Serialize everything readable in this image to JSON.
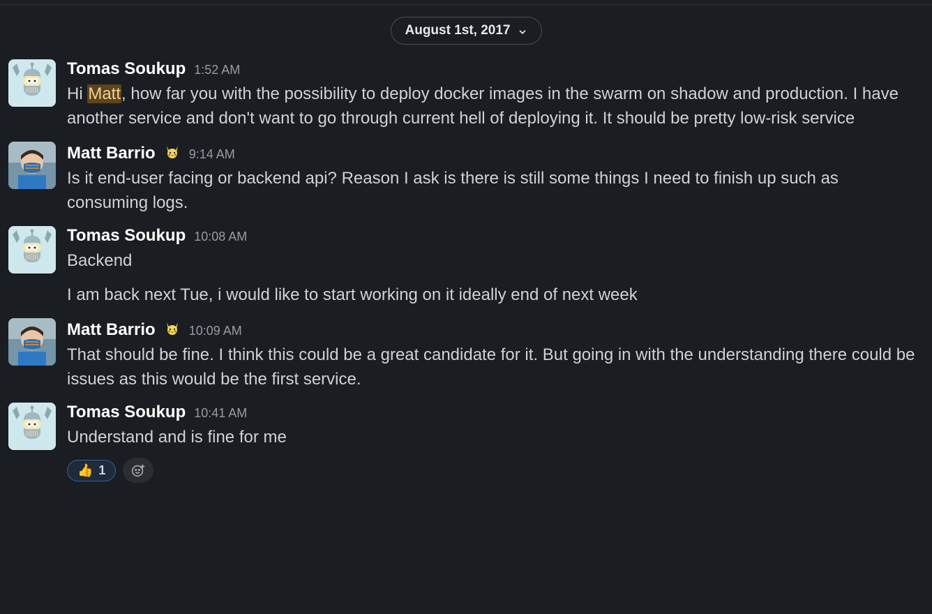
{
  "date_divider": "August 1st, 2017",
  "highlight_term": "Matt",
  "messages": [
    {
      "author": "Tomas Soukup",
      "avatar": "bender",
      "status_emoji": "",
      "time": "1:52 AM",
      "paragraphs": [
        "Hi Matt, how far you with the possibility to deploy docker images in the swarm on shadow and production. I have another service and don't want to go through current hell of deploying it. It should be pretty low-risk service"
      ]
    },
    {
      "author": "Matt Barrio",
      "avatar": "matt",
      "status_emoji": "pikachu",
      "time": "9:14 AM",
      "paragraphs": [
        "Is it end-user facing or backend api? Reason I ask is there is still some things I need to finish up such as consuming logs."
      ]
    },
    {
      "author": "Tomas Soukup",
      "avatar": "bender",
      "status_emoji": "",
      "time": "10:08 AM",
      "paragraphs": [
        "Backend",
        "I am back next Tue, i would like to start working on it ideally end of next week"
      ]
    },
    {
      "author": "Matt Barrio",
      "avatar": "matt",
      "status_emoji": "pikachu",
      "time": "10:09 AM",
      "paragraphs": [
        "That should be fine. I think this could be a great candidate for it. But going in with the understanding there could be issues as this would be the first service."
      ]
    },
    {
      "author": "Tomas Soukup",
      "avatar": "bender",
      "status_emoji": "",
      "time": "10:41 AM",
      "paragraphs": [
        "Understand and is fine for me"
      ],
      "reactions": [
        {
          "emoji": "👍",
          "count": 1,
          "name": "thumbs-up"
        }
      ]
    }
  ]
}
